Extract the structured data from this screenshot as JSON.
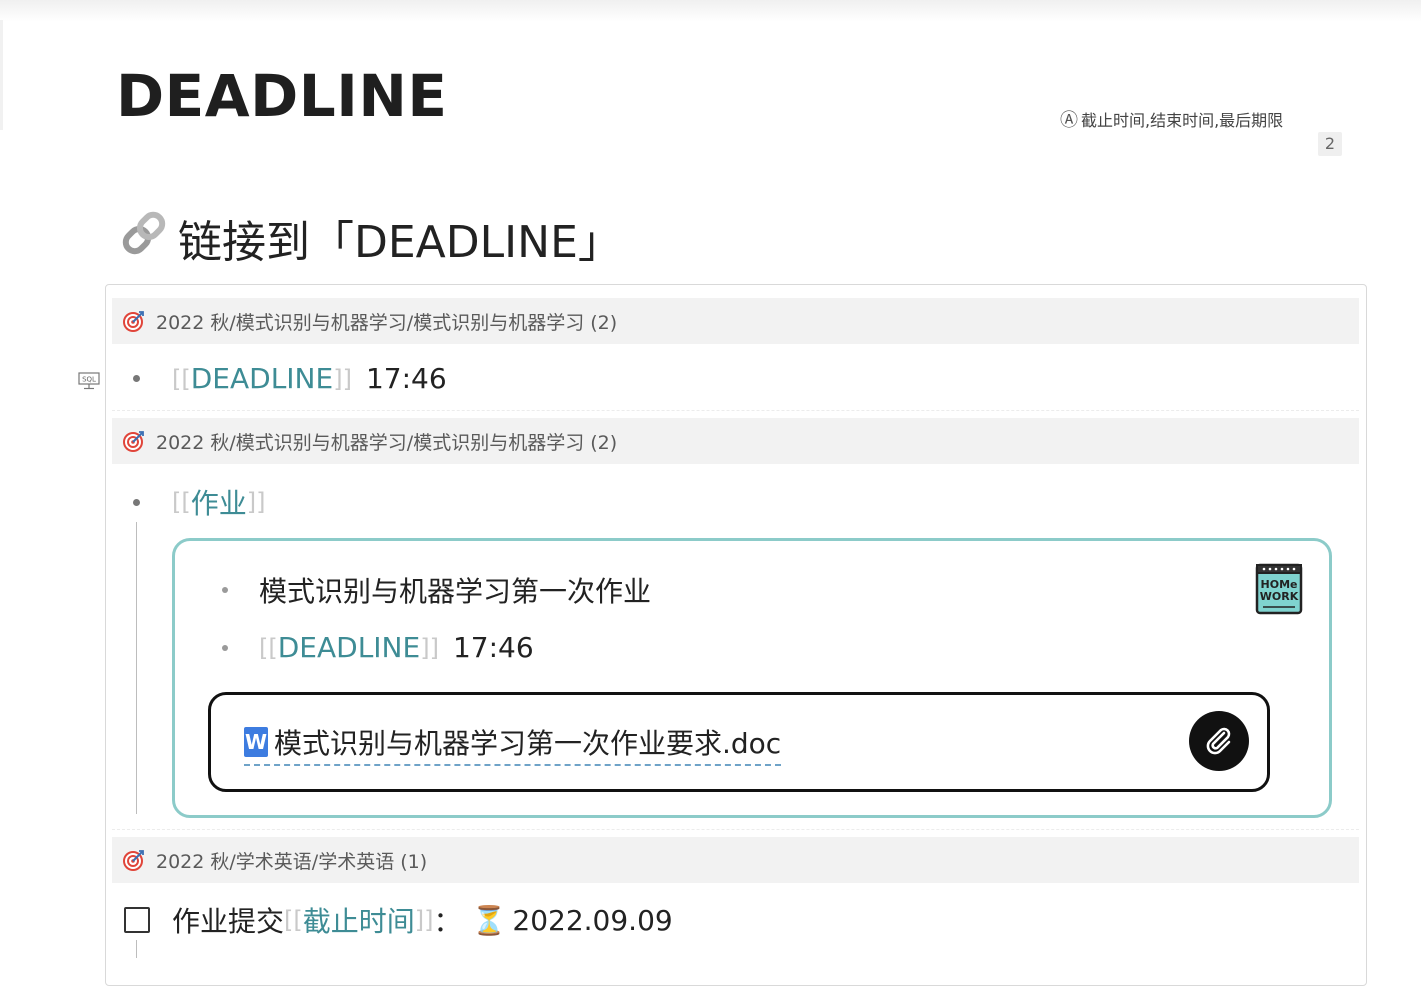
{
  "page": {
    "title": "DEADLINE",
    "alias_icon": "Ⓐ",
    "aliases": "截止时间,结束时间,最后期限",
    "ref_count": "2"
  },
  "backlinks": {
    "icon": "link-icon",
    "heading": "链接到「DEADLINE」",
    "groups": [
      {
        "path": "2022 秋/模式识别与机器学习/模式识别与机器学习 (2)",
        "bracket_open": "[[",
        "link": "DEADLINE",
        "bracket_close": "]]",
        "after": "17:46"
      },
      {
        "path": "2022 秋/模式识别与机器学习/模式识别与机器学习 (2)",
        "bracket_open": "[[",
        "link": "作业",
        "bracket_close": "]]",
        "callout": {
          "item1": "模式识别与机器学习第一次作业",
          "item2_link": "DEADLINE",
          "item2_after": "17:46",
          "attachment": "模式识别与机器学习第一次作业要求.doc",
          "word_letter": "W"
        }
      },
      {
        "path": "2022 秋/学术英语/学术英语 (1)",
        "task_text": "作业提交",
        "task_link": "截止时间",
        "task_colon": "：",
        "task_icon": "⏳",
        "task_date": "2022.09.09"
      }
    ]
  },
  "icons": {
    "sql": "SQL",
    "homework_top": "HOMe",
    "homework_bottom": "WORK"
  }
}
